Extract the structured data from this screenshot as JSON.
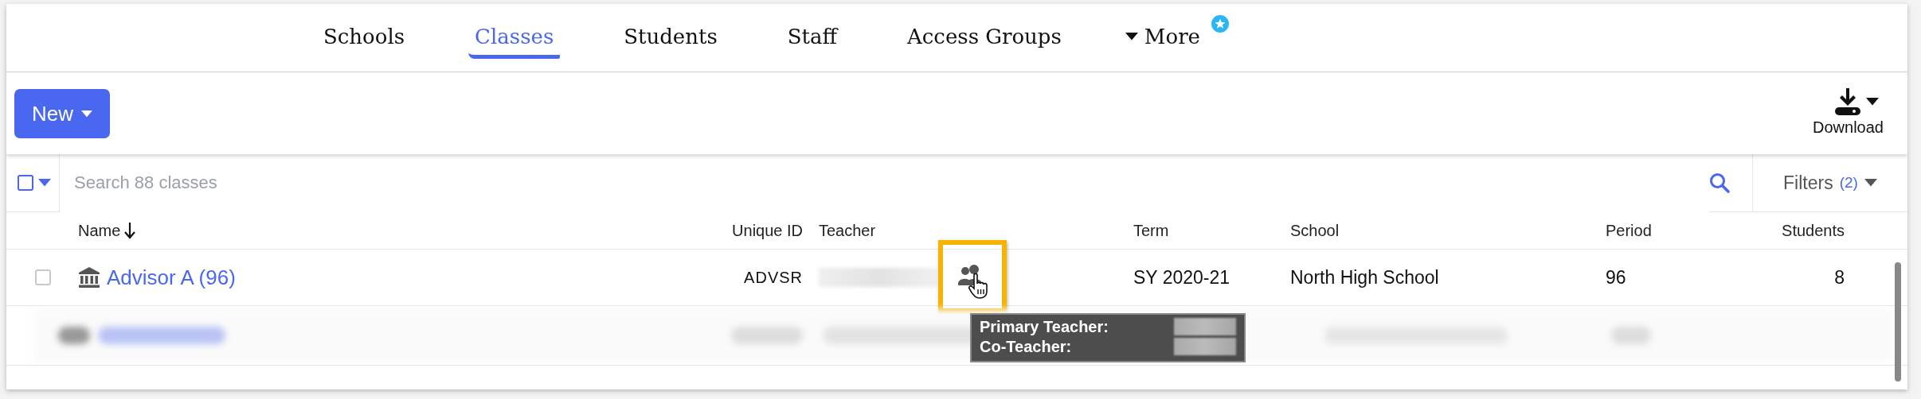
{
  "nav": {
    "tabs": [
      {
        "label": "Schools",
        "selected": false
      },
      {
        "label": "Classes",
        "selected": true
      },
      {
        "label": "Students",
        "selected": false
      },
      {
        "label": "Staff",
        "selected": false
      },
      {
        "label": "Access Groups",
        "selected": false
      }
    ],
    "more": {
      "label": "More",
      "badge": true
    }
  },
  "toolbar": {
    "new_button": "New",
    "download": "Download"
  },
  "search": {
    "select_all_checked": false,
    "placeholder": "Search 88 classes",
    "filters_label": "Filters",
    "filters_count": "(2)"
  },
  "table": {
    "columns": [
      {
        "label": "Name",
        "sorted": true
      },
      {
        "label": "Unique ID",
        "sorted": false
      },
      {
        "label": "Teacher",
        "sorted": false
      },
      {
        "label": "Term",
        "sorted": false
      },
      {
        "label": "School",
        "sorted": false
      },
      {
        "label": "Period",
        "sorted": false
      },
      {
        "label": "Students",
        "sorted": false
      }
    ],
    "rows": [
      {
        "checked": false,
        "name": "Advisor A (96)",
        "unique_id": "ADVSR",
        "term": "SY 2020-21",
        "school": "North High School",
        "period": "96",
        "students": "8",
        "highlighted": true
      }
    ]
  },
  "tooltip": {
    "lines": [
      "Primary Teacher:",
      "Co-Teacher:"
    ]
  }
}
